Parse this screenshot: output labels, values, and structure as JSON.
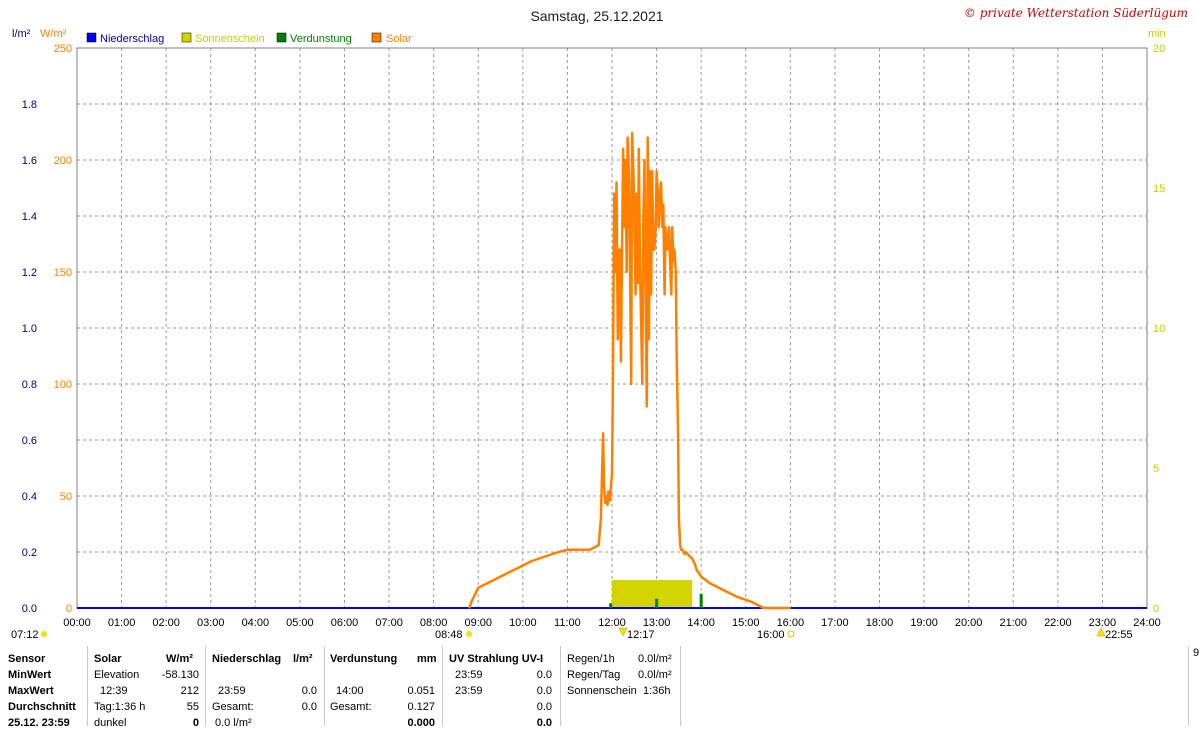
{
  "header": {
    "title": "Samstag, 25.12.2021",
    "copyright": "© private Wetterstation Süderlügum"
  },
  "axes": {
    "left_unit_rain": "l/m²",
    "left_unit_solar": "W/m²",
    "right_unit": "min"
  },
  "legend": [
    {
      "label": "Niederschlag",
      "color": "#0000ff"
    },
    {
      "label": "Sonnenschein",
      "color": "#d4d400"
    },
    {
      "label": "Verdunstung",
      "color": "#007f00"
    },
    {
      "label": "Solar",
      "color": "#ff7f00"
    }
  ],
  "sun_events": {
    "sunrise": "07:12",
    "light_start": "08:48",
    "max_sun": "12:17",
    "light_end": "16:00",
    "moon": "22:55"
  },
  "chart_data": {
    "type": "line",
    "title": "Samstag, 25.12.2021",
    "x_ticks": [
      "00:00",
      "01:00",
      "02:00",
      "03:00",
      "04:00",
      "05:00",
      "06:00",
      "07:00",
      "08:00",
      "09:00",
      "10:00",
      "11:00",
      "12:00",
      "13:00",
      "14:00",
      "15:00",
      "16:00",
      "17:00",
      "18:00",
      "19:00",
      "20:00",
      "21:00",
      "22:00",
      "23:00",
      "24:00"
    ],
    "y_left_rain_ticks": [
      "0.0",
      "0.2",
      "0.4",
      "0.6",
      "0.8",
      "1.0",
      "1.2",
      "1.4",
      "1.6",
      "1.8"
    ],
    "y_left_rain_ylim": [
      0,
      2
    ],
    "y_left_solar_ticks": [
      "0",
      "50",
      "100",
      "150",
      "200",
      "250"
    ],
    "y_left_solar_ylim": [
      0,
      250
    ],
    "y_right_ticks": [
      "0",
      "5",
      "10",
      "15",
      "20"
    ],
    "y_right_ylim": [
      0,
      20
    ],
    "grid": true,
    "legend_position": "top-left",
    "series": [
      {
        "name": "Solar",
        "color": "#ff7f00",
        "unit": "W/m²",
        "x_hours": [
          8.8,
          8.85,
          9.0,
          9.3,
          9.6,
          9.9,
          10.2,
          10.5,
          10.8,
          11.0,
          11.3,
          11.5,
          11.6,
          11.7,
          11.75,
          11.8,
          11.82,
          11.85,
          11.88,
          11.9,
          11.92,
          11.95,
          12.0,
          12.02,
          12.05,
          12.08,
          12.1,
          12.13,
          12.15,
          12.18,
          12.2,
          12.23,
          12.25,
          12.28,
          12.3,
          12.33,
          12.35,
          12.38,
          12.4,
          12.43,
          12.45,
          12.48,
          12.5,
          12.53,
          12.55,
          12.58,
          12.6,
          12.63,
          12.65,
          12.68,
          12.7,
          12.73,
          12.75,
          12.78,
          12.8,
          12.83,
          12.85,
          12.88,
          12.9,
          12.93,
          12.95,
          12.98,
          13.0,
          13.03,
          13.05,
          13.08,
          13.1,
          13.13,
          13.15,
          13.18,
          13.2,
          13.23,
          13.25,
          13.28,
          13.3,
          13.33,
          13.35,
          13.38,
          13.4,
          13.43,
          13.45,
          13.48,
          13.5,
          13.53,
          13.55,
          13.58,
          13.6,
          13.63,
          13.65,
          13.7,
          13.75,
          13.8,
          13.85,
          13.9,
          14.0,
          14.2,
          14.5,
          14.8,
          15.1,
          15.4,
          15.7,
          15.9,
          16.0
        ],
        "y": [
          0,
          3,
          9,
          12,
          15,
          18,
          21,
          23,
          25,
          26,
          26,
          26,
          27,
          28,
          40,
          78,
          55,
          47,
          50,
          46,
          52,
          48,
          60,
          100,
          185,
          150,
          190,
          120,
          160,
          160,
          110,
          170,
          205,
          170,
          200,
          150,
          210,
          195,
          160,
          100,
          212,
          195,
          175,
          140,
          185,
          145,
          205,
          150,
          130,
          100,
          170,
          200,
          150,
          90,
          210,
          120,
          195,
          140,
          195,
          160,
          160,
          170,
          195,
          185,
          170,
          185,
          190,
          170,
          180,
          140,
          170,
          160,
          160,
          170,
          155,
          140,
          170,
          155,
          160,
          150,
          115,
          80,
          40,
          28,
          26,
          26,
          25,
          24,
          25,
          24,
          23,
          22,
          20,
          17,
          14,
          11,
          8,
          5,
          3,
          0,
          0,
          0,
          0,
          0,
          0
        ],
        "y_axis": "solar"
      },
      {
        "name": "Sonnenschein",
        "color": "#d4d400",
        "unit": "min",
        "x_start_hour": 12.0,
        "x_end_hour": 13.8,
        "value_min": 1,
        "y_axis": "right"
      },
      {
        "name": "Verdunstung",
        "color": "#007f00",
        "unit": "mm",
        "x_hours": [
          11.97,
          13.0,
          14.0
        ],
        "values": [
          0.017,
          0.033,
          0.051
        ],
        "y_axis": "rain"
      },
      {
        "name": "Niederschlag",
        "color": "#0000ff",
        "unit": "l/m²",
        "values_total": 0.0,
        "y_axis": "rain"
      }
    ]
  },
  "stats": {
    "headers": {
      "sensor": "Sensor",
      "solar": "Solar",
      "solar_unit": "W/m²",
      "rain": "Niederschlag",
      "rain_unit": "l/m²",
      "evap": "Verdunstung",
      "evap_unit": "mm",
      "uv": "UV Strahlung UV-I"
    },
    "row_labels": [
      "MinWert",
      "MaxWert",
      "Durchschnitt",
      "25.12. 23:59"
    ],
    "solar": {
      "min_label": "Elevation",
      "min_value": "-58.130",
      "max_time": "12:39",
      "max_value": "212",
      "avg_label": "Tag:1:36 h",
      "avg_value": "55",
      "now_label": "dunkel",
      "now_value": "0"
    },
    "rain": {
      "max_time": "23:59",
      "max_value": "0.0",
      "total_label": "Gesamt:",
      "total_value": "0.0",
      "now_value": "0.0 l/m²"
    },
    "evap": {
      "max_time": "14:00",
      "max_value": "0.051",
      "total_label": "Gesamt:",
      "total_value": "0.127",
      "now_value": "0.000"
    },
    "uv": {
      "min_time": "23:59",
      "min_value": "0.0",
      "max_time": "23:59",
      "max_value": "0.0",
      "avg_value": "0.0",
      "now_value": "0.0"
    },
    "extra": {
      "rain_1h_label": "Regen/1h",
      "rain_1h_value": "0.0l/m²",
      "rain_day_label": "Regen/Tag",
      "rain_day_value": "0.0l/m²",
      "sun_label": "Sonnenschein",
      "sun_value": "1:36h"
    },
    "edge_value": "9"
  }
}
